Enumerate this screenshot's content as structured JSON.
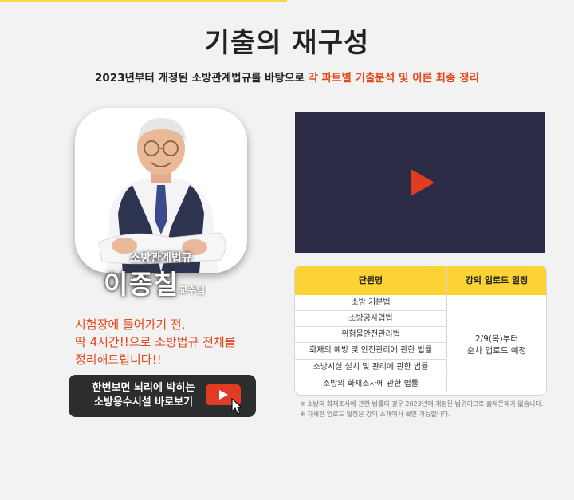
{
  "header": {
    "title": "기출의 재구성",
    "subtitle_prefix": "2023년부터 개정된 소방관계법규를 바탕으로",
    "subtitle_highlight": "각 파트별 기출분석 및 이론 최종 정리"
  },
  "instructor": {
    "subject": "소방관계법규",
    "name": "이종칠",
    "suffix": "교수님"
  },
  "description": {
    "line1": "시험장에 들어가기 전,",
    "line2": "딱 4시간!!으로 소방법규 전체를",
    "line3": "정리해드립니다!!"
  },
  "cta": {
    "line1": "한번보면 뇌리에 박히는",
    "line2": "소방용수시설 바로보기"
  },
  "table": {
    "headers": [
      "단원명",
      "강의 업로드 일정"
    ],
    "rows": [
      "소방 기본법",
      "소방공사업법",
      "위험물안전관리법",
      "화재의 예방 및 안전관리에 관한 법률",
      "소방시설 설치 및 관리에 관한 법률",
      "소방의 화재조사에 관한 법률"
    ],
    "schedule_line1": "2/9(목)부터",
    "schedule_line2": "순차 업로드 예정"
  },
  "notes": [
    "※ 소방의 화재조사에 관한 법률의 경우 2023년에 개정된 범위이므로 출제문제가 없습니다.",
    "※ 자세한 업로드 일정은 강의 소개에서 확인 가능합니다."
  ],
  "colors": {
    "accent": "#e2491c",
    "table_header": "#fbd335",
    "video_bg": "#2c2c46",
    "play": "#e23b24"
  },
  "icons": {
    "video": "play-icon",
    "cta": "youtube-play-icon",
    "pointer": "cursor-pointer-icon"
  }
}
